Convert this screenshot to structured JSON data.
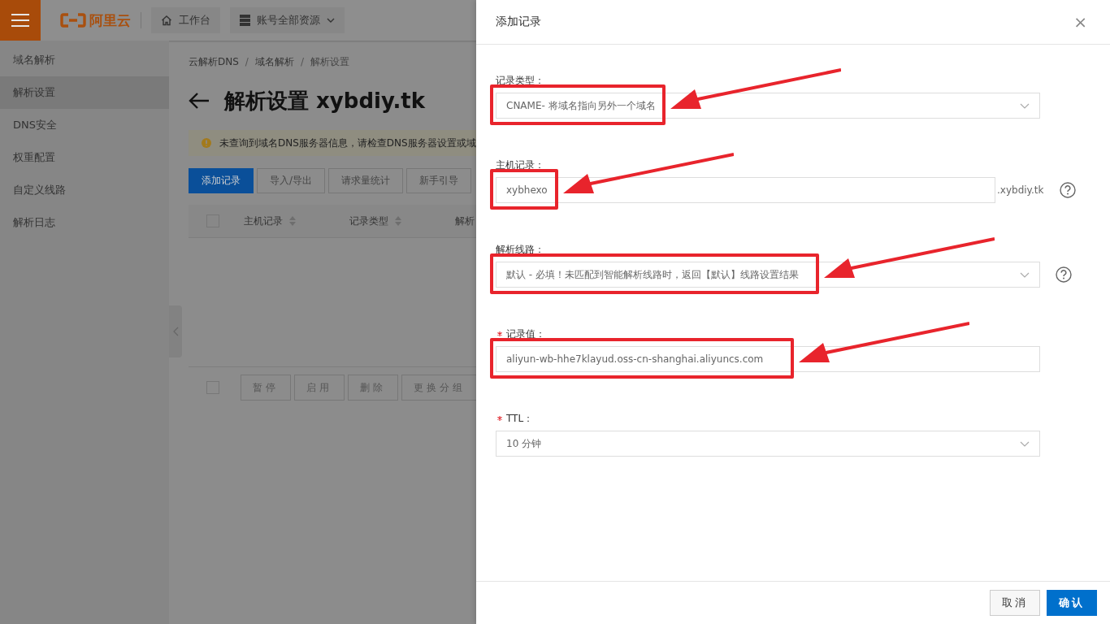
{
  "topbar": {
    "logo": "阿里云",
    "nav": [
      {
        "label": "工作台",
        "dropdown": false
      },
      {
        "label": "账号全部资源",
        "dropdown": true
      }
    ]
  },
  "sidebar": {
    "items": [
      {
        "label": "域名解析",
        "selected": false
      },
      {
        "label": "解析设置",
        "selected": true
      },
      {
        "label": "DNS安全",
        "selected": false
      },
      {
        "label": "权重配置",
        "selected": false
      },
      {
        "label": "自定义线路",
        "selected": false
      },
      {
        "label": "解析日志",
        "selected": false
      }
    ]
  },
  "breadcrumb": [
    "云解析DNS",
    "/",
    "域名解析",
    "/",
    "解析设置"
  ],
  "page_title": "解析设置 xybdiy.tk",
  "alert": "未查询到域名DNS服务器信息，请检查DNS服务器设置或域",
  "toolbar": [
    {
      "label": "添加记录",
      "primary": true
    },
    {
      "label": "导入/导出",
      "primary": false
    },
    {
      "label": "请求量统计",
      "primary": false
    },
    {
      "label": "新手引导",
      "primary": false
    }
  ],
  "table": {
    "select_all": {
      "checked": false
    },
    "columns": [
      {
        "label": "主机记录",
        "sortable": true
      },
      {
        "label": "记录类型",
        "sortable": true
      },
      {
        "label": "解析",
        "sortable": false
      }
    ]
  },
  "batch_select": {
    "checked": false
  },
  "batch_actions": [
    "暂停",
    "启用",
    "删除",
    "更换分组"
  ],
  "drawer": {
    "title": "添加记录",
    "close": "×",
    "fields": [
      {
        "label": "记录类型：",
        "required": false,
        "kind": "select",
        "value": "CNAME- 将域名指向另外一个域名",
        "help": false,
        "highlighted": true
      },
      {
        "label": "主机记录：",
        "required": false,
        "kind": "input",
        "value": "xybhexo",
        "suffix": ".xybdiy.tk",
        "help": true,
        "highlighted": true
      },
      {
        "label": "解析线路：",
        "required": false,
        "kind": "select",
        "value": "默认 - 必填！未匹配到智能解析线路时，返回【默认】线路设置结果",
        "help": true,
        "highlighted": true
      },
      {
        "label": "记录值：",
        "required": true,
        "kind": "input",
        "value": "aliyun-wb-hhe7klayud.oss-cn-shanghai.aliyuncs.com",
        "help": false,
        "highlighted": true
      },
      {
        "label": "TTL：",
        "required": true,
        "kind": "select",
        "value": "10 分钟",
        "help": false,
        "highlighted": false
      }
    ],
    "buttons": [
      {
        "label": "取消",
        "primary": false
      },
      {
        "label": "确认",
        "primary": true
      }
    ]
  }
}
